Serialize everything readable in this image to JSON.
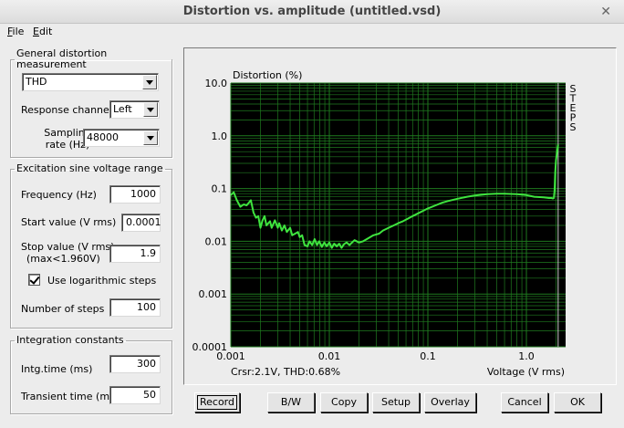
{
  "window": {
    "title": "Distortion vs. amplitude (untitled.vsd)",
    "close_glyph": "✕"
  },
  "menu": [
    "File",
    "Edit"
  ],
  "general": {
    "legend": "General distortion measurement",
    "measure_value": "THD",
    "channel_label": "Response channel",
    "channel_value": "Left",
    "rate_label_1": "Sampling",
    "rate_label_2": "rate (Hz)",
    "rate_value": "48000"
  },
  "excitation": {
    "legend": "Excitation sine voltage range",
    "freq_label": "Frequency (Hz)",
    "freq_value": "1000",
    "start_label": "Start value (V rms)",
    "start_value": "0.0001",
    "stop_label_1": "Stop value (V rms)",
    "stop_label_2": "(max<1.960V)",
    "stop_value": "1.9",
    "log_label": "Use logarithmic steps",
    "log_checked": true,
    "steps_label": "Number of steps",
    "steps_value": "100"
  },
  "integration": {
    "legend": "Integration constants",
    "intg_label": "Intg.time (ms)",
    "intg_value": "300",
    "transient_label": "Transient time (ms)",
    "transient_value": "50"
  },
  "buttons": {
    "record": "Record",
    "bw": "B/W",
    "copy": "Copy",
    "setup": "Setup",
    "overlay": "Overlay",
    "cancel": "Cancel",
    "ok": "OK"
  },
  "chart_data": {
    "type": "line",
    "title": "Distortion (%)",
    "xlabel": "Voltage (V rms)",
    "ylabel": "Distortion (%)",
    "x_scale": "log",
    "y_scale": "log",
    "xlim": [
      0.001,
      2.5
    ],
    "ylim": [
      0.0001,
      10.0
    ],
    "x_ticks": [
      "0.001",
      "0.01",
      "0.1",
      "1.0"
    ],
    "x_tick_values": [
      0.001,
      0.01,
      0.1,
      1.0
    ],
    "y_ticks": [
      "10.0",
      "1.0",
      "0.1",
      "0.01",
      "0.001",
      "0.0001"
    ],
    "y_tick_values": [
      10,
      1,
      0.1,
      0.01,
      0.001,
      0.0001
    ],
    "cursor_readout": "Crsr:2.1V, THD:0.68%",
    "side_label": "STEPS",
    "grid": true,
    "colors": {
      "background": "#000000",
      "grid": "#1f7a1f",
      "line": "#3fe43f",
      "cursor": "#c8c8c8"
    },
    "cursor_x": 2.1,
    "series": [
      {
        "x": [
          0.001,
          0.00107,
          0.00115,
          0.00125,
          0.00135,
          0.00145,
          0.0016,
          0.0017,
          0.0018,
          0.0019,
          0.002,
          0.0021,
          0.0022,
          0.0023,
          0.0025,
          0.0026,
          0.0028,
          0.003,
          0.0031,
          0.0033,
          0.0035,
          0.0037,
          0.004,
          0.0042,
          0.0045,
          0.0048,
          0.005,
          0.0053,
          0.0056,
          0.006,
          0.0063,
          0.0067,
          0.0071,
          0.0075,
          0.0079,
          0.0084,
          0.0089,
          0.0094,
          0.01,
          0.0106,
          0.0112,
          0.0119,
          0.0126,
          0.0133,
          0.0141,
          0.015,
          0.016,
          0.017,
          0.018,
          0.02,
          0.022,
          0.025,
          0.028,
          0.032,
          0.035,
          0.04,
          0.045,
          0.05,
          0.056,
          0.063,
          0.07,
          0.08,
          0.09,
          0.1,
          0.12,
          0.14,
          0.16,
          0.2,
          0.25,
          0.3,
          0.4,
          0.5,
          0.6,
          0.8,
          1.0,
          1.2,
          1.5,
          1.7,
          1.8,
          1.85,
          1.9,
          1.93,
          1.96,
          2.0,
          2.05,
          2.1
        ],
        "y": [
          0.075,
          0.085,
          0.06,
          0.045,
          0.05,
          0.048,
          0.06,
          0.035,
          0.028,
          0.03,
          0.018,
          0.025,
          0.03,
          0.02,
          0.024,
          0.018,
          0.025,
          0.018,
          0.022,
          0.016,
          0.02,
          0.015,
          0.018,
          0.013,
          0.014,
          0.015,
          0.012,
          0.013,
          0.0085,
          0.008,
          0.01,
          0.0085,
          0.011,
          0.0085,
          0.01,
          0.0078,
          0.0095,
          0.008,
          0.0095,
          0.0075,
          0.009,
          0.008,
          0.009,
          0.0075,
          0.0088,
          0.0095,
          0.0085,
          0.0095,
          0.0105,
          0.0095,
          0.01,
          0.0115,
          0.013,
          0.014,
          0.016,
          0.018,
          0.02,
          0.022,
          0.024,
          0.027,
          0.03,
          0.034,
          0.038,
          0.042,
          0.048,
          0.054,
          0.058,
          0.064,
          0.07,
          0.074,
          0.078,
          0.08,
          0.08,
          0.078,
          0.075,
          0.07,
          0.068,
          0.066,
          0.066,
          0.065,
          0.066,
          0.09,
          0.2,
          0.35,
          0.5,
          0.68
        ]
      }
    ]
  }
}
